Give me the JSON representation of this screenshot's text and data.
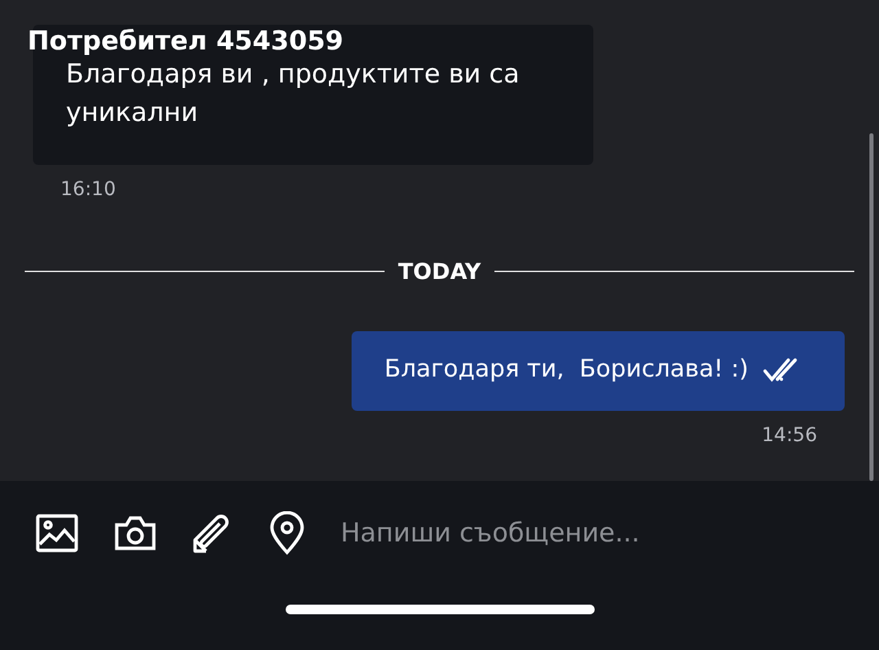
{
  "header": {
    "title": "Потребител 4543059"
  },
  "messages": [
    {
      "kind": "incoming",
      "text": "Благодаря ви , продуктите ви са уникални",
      "time": "16:10"
    },
    {
      "kind": "divider",
      "text": "TODAY"
    },
    {
      "kind": "outgoing",
      "text": "Благодаря ти,  Борислава! :)",
      "time": "14:56",
      "read": true
    }
  ],
  "composer": {
    "placeholder": "Напиши съобщение..."
  }
}
